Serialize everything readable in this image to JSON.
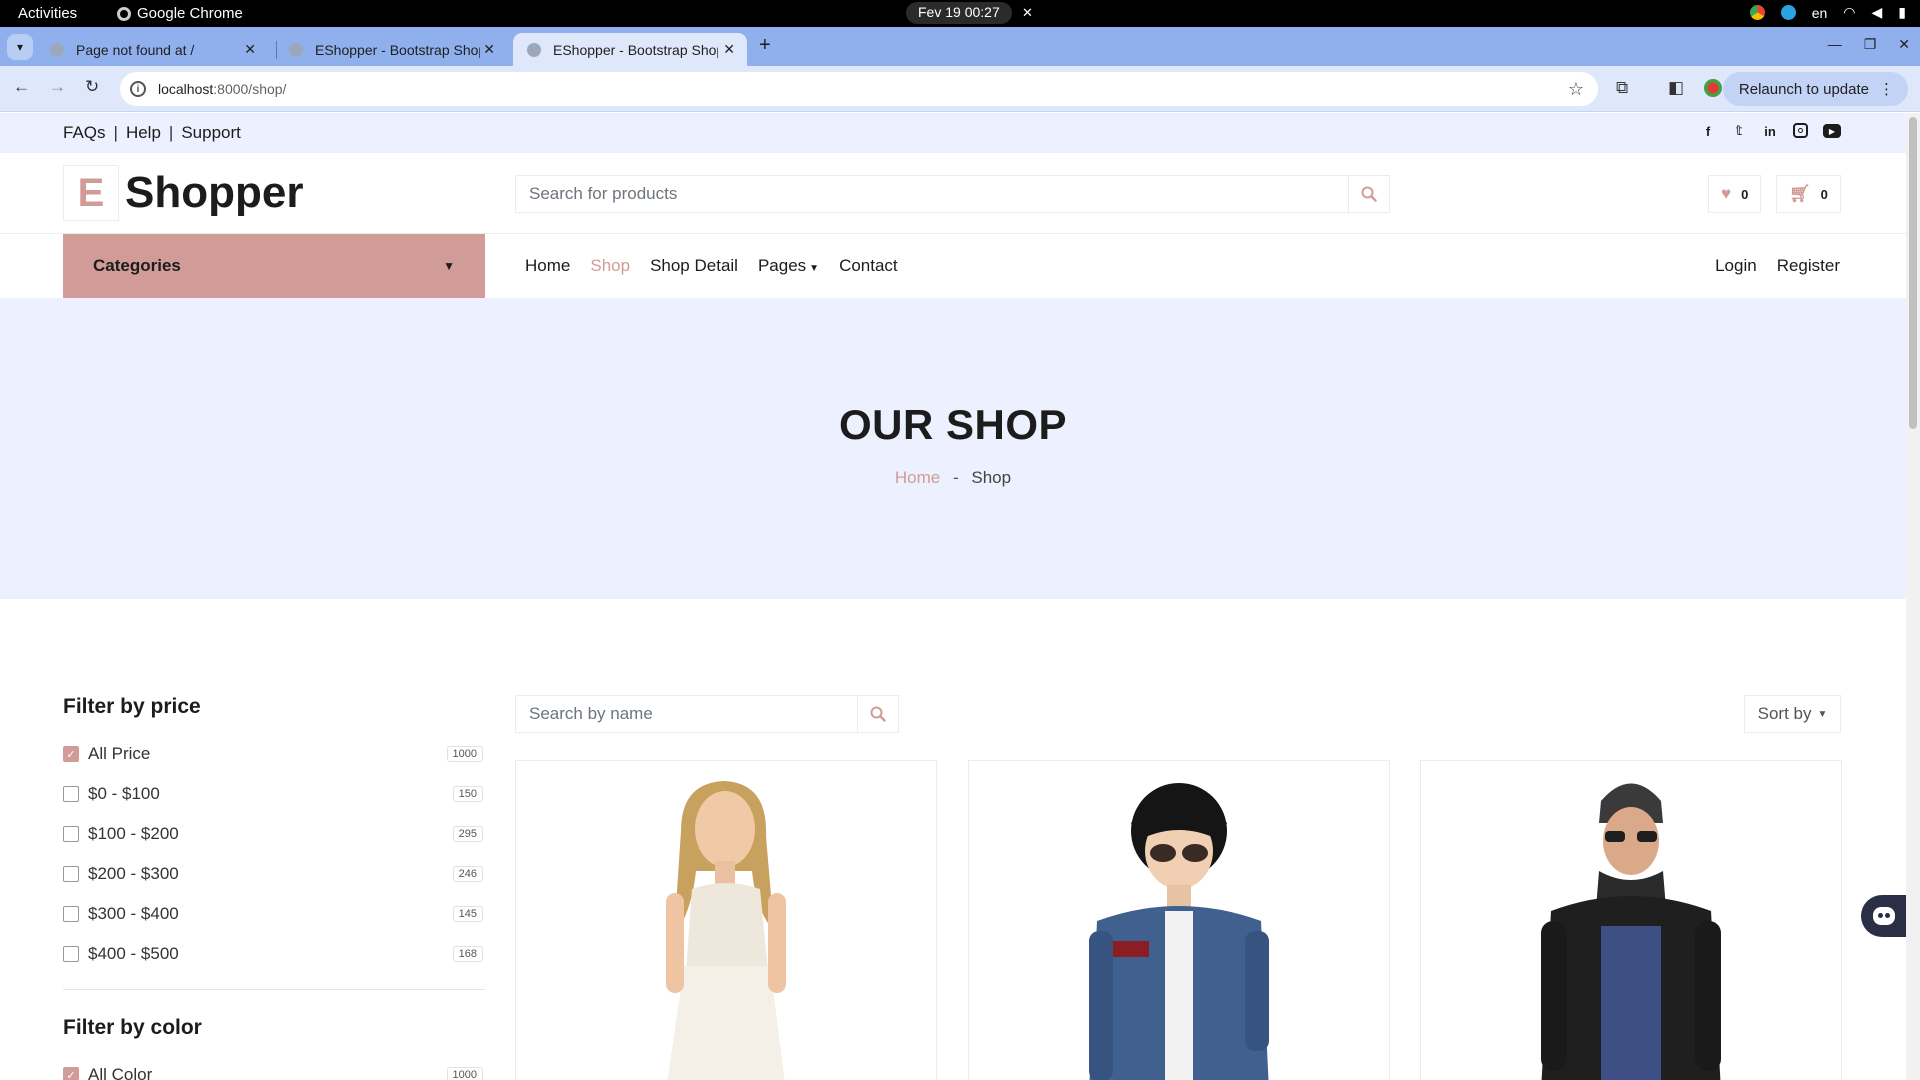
{
  "system_bar": {
    "activities": "Activities",
    "app_name": "Google Chrome",
    "clock": "Fev 19  00:27",
    "language": "en"
  },
  "browser": {
    "tabs": [
      {
        "title": "Page not found at /"
      },
      {
        "title": "EShopper - Bootstrap Shop Template"
      },
      {
        "title": "EShopper - Bootstrap Shop Template"
      }
    ],
    "active_tab": 2,
    "url_host": "localhost",
    "url_rest": ":8000/shop/",
    "relaunch_label": "Relaunch to update"
  },
  "site": {
    "top_links": [
      "FAQs",
      "Help",
      "Support"
    ],
    "top_sep": "|",
    "social_icons": [
      "facebook-icon",
      "twitter-icon",
      "linkedin-icon",
      "instagram-icon",
      "youtube-icon"
    ],
    "logo_letter": "E",
    "logo_text": "Shopper",
    "search_placeholder": "Search for products",
    "wishlist_count": "0",
    "cart_count": "0",
    "categories_label": "Categories",
    "nav": [
      "Home",
      "Shop",
      "Shop Detail",
      "Pages",
      "Contact"
    ],
    "active_nav": "Shop",
    "login": "Login",
    "register": "Register",
    "accent_color": "#d19c97",
    "light_bg": "#edf1ff"
  },
  "hero": {
    "title": "OUR SHOP",
    "crumb_home": "Home",
    "crumb_sep": "-",
    "crumb_current": "Shop"
  },
  "filters": {
    "price_title": "Filter by price",
    "price_options": [
      {
        "label": "All Price",
        "count": "1000",
        "checked": true
      },
      {
        "label": "$0 - $100",
        "count": "150",
        "checked": false
      },
      {
        "label": "$100 - $200",
        "count": "295",
        "checked": false
      },
      {
        "label": "$200 - $300",
        "count": "246",
        "checked": false
      },
      {
        "label": "$300 - $400",
        "count": "145",
        "checked": false
      },
      {
        "label": "$400 - $500",
        "count": "168",
        "checked": false
      }
    ],
    "color_title": "Filter by color",
    "color_options": [
      {
        "label": "All Color",
        "count": "1000",
        "checked": true
      }
    ]
  },
  "shop": {
    "search_placeholder": "Search by name",
    "sort_label": "Sort by"
  }
}
